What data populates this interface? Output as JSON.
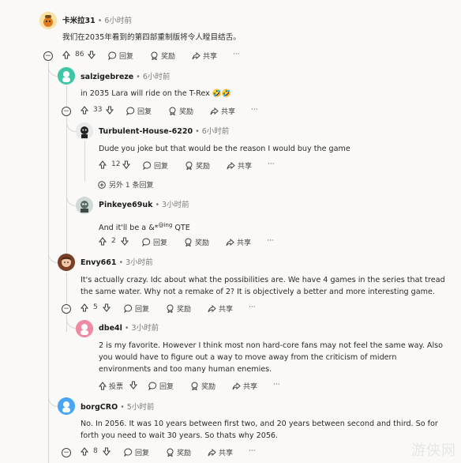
{
  "actions": {
    "reply": "回复",
    "award": "奖励",
    "share": "共享",
    "vote": "投票",
    "more": "···",
    "dot": "•"
  },
  "comments": [
    {
      "user": "卡米拉31",
      "time": "6小时前",
      "body": "我们在2035年看到的第四部重制版将令人瞠目结舌。",
      "score": "86"
    },
    {
      "user": "salzigebreze",
      "time": "6小时前",
      "body": "in 2035 Lara will ride on the T-Rex 🤣🤣",
      "score": "33"
    },
    {
      "user": "Turbulent-House-6220",
      "time": "6小时前",
      "body": "Dude you joke but that would be the reason I would buy the game",
      "score": "12"
    },
    {
      "user": "Pinkeye69uk",
      "time": "3小时前",
      "body_pre": "And it'll be a &*",
      "body_sup": "@ing",
      "body_post": " QTE",
      "score": "2"
    },
    {
      "user": "Envy661",
      "time": "3小时前",
      "body": "It's actually crazy. Idc about what the possibilities are. We have 4 games in the series that tread the same water. Why not a remake of 2? It is objectively a better and more interesting game.",
      "score": "5"
    },
    {
      "user": "dbe4l",
      "time": "3小时前",
      "body": "2 is my favorite. However I think most non hard-core fans may not feel the same way. Also you would have to figure out a way to move away from the criticism of midern environments and too many human enemies."
    },
    {
      "user": "borgCRO",
      "time": "5小时前",
      "body": "No. In 2056. It was 10 years between first two, and 20 years between second and third. So for forth you need to wait 30 years. So thats why 2056.",
      "score": "8"
    }
  ],
  "more_replies": "另外 1 条回复",
  "watermark": "游侠网",
  "colors": {
    "background": "#faf9f7",
    "thread_line": "#d6d6d6",
    "muted": "#7c7c7c"
  }
}
